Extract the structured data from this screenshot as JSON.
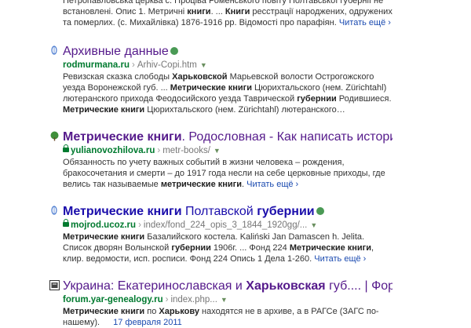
{
  "results": [
    {
      "title_parts": [],
      "domain": "",
      "path": "",
      "snippet_html": "Петропавловська церква с. Проціва Роменського повіту Полтавської губернії не встановлені. Опис 1. Метричні <b>книги</b>. ... <b>Книги</b> ресстрації народжених, одружених та померлих. (с. Михайлівка) 1876-1916 рр. Відомості про парафіян.",
      "more": "Читать ещё ›"
    },
    {
      "title_parts": [
        {
          "text": "Архивные данные",
          "bold": false
        }
      ],
      "domain": "rodmurmana.ru",
      "path": "Arhiv-Copi.htm",
      "lock": false,
      "snippet_html": "Ревизская сказка слободы <b>Харьковской</b> Марьевской волости Острогожского уезда Воронежской губ. ... <b>Метрические книги</b> Цюрихтальского (нем. Zürichtahl) лютеранского прихода Феодосийского уезда Таврической <b>губернии</b> Родившиеся. <b>Метрические книги</b> Цюрихтальского (нем. Zürichtahl) лютеранского…",
      "more": ""
    },
    {
      "title_parts": [
        {
          "text": "Метрические книги",
          "bold": true
        },
        {
          "text": ". Родословная - Как написать историю...",
          "bold": false
        }
      ],
      "domain": "yulianovozhilova.ru",
      "path": "metr-books/",
      "lock": true,
      "snippet_html": "Обязанность по учету важных событий в жизни человека – рождения, бракосочетания и смерти – до 1917 года несли на себе церковные приходы, где велись так называемые <b>метрические книги</b>.",
      "more": "Читать ещё ›"
    },
    {
      "title_parts": [
        {
          "text": "Метрические книги",
          "bold": true
        },
        {
          "text": " Полтавской ",
          "bold": false
        },
        {
          "text": "губернии",
          "bold": true
        }
      ],
      "domain": "mojrod.ucoz.ru",
      "path": "index/fond_224_opis_3_1844_1920gg/...",
      "lock": true,
      "snippet_html": "<b>Метрические книги</b> Базалийского костела. Kaliński Jan Damascen h. Jelita. Список дворян Волынской <b>губернии</b> 1906г. ... Фонд 224 <b>Метрические книги</b>, клир. ведомости, исп. росписи. Фонд 224 Опись 1 Дела 1-260.",
      "more": "Читать ещё ›"
    },
    {
      "title_parts": [
        {
          "text": "Украина: Екатеринославская и ",
          "bold": false
        },
        {
          "text": "Харьковская",
          "bold": true
        },
        {
          "text": " губ.... | Форум",
          "bold": false
        }
      ],
      "domain": "forum.yar-genealogy.ru",
      "path": "index.php...",
      "lock": false,
      "snippet_html": "<b>Метрические книги</b> по <b>Харькову</b> находятся не в архиве, а в РАГСе (ЗАГС по-нашему).",
      "date": "17 февраля 2011",
      "more": ""
    }
  ],
  "colors": {
    "link_visited": "#551a8b",
    "domain_green": "#007a2f",
    "more_blue": "#1a4ab0"
  },
  "icons": [
    "globe-icon",
    "green-tree-icon",
    "forum-book-icon",
    "verified-badge-icon",
    "lock-icon",
    "dropdown-arrow-icon"
  ]
}
